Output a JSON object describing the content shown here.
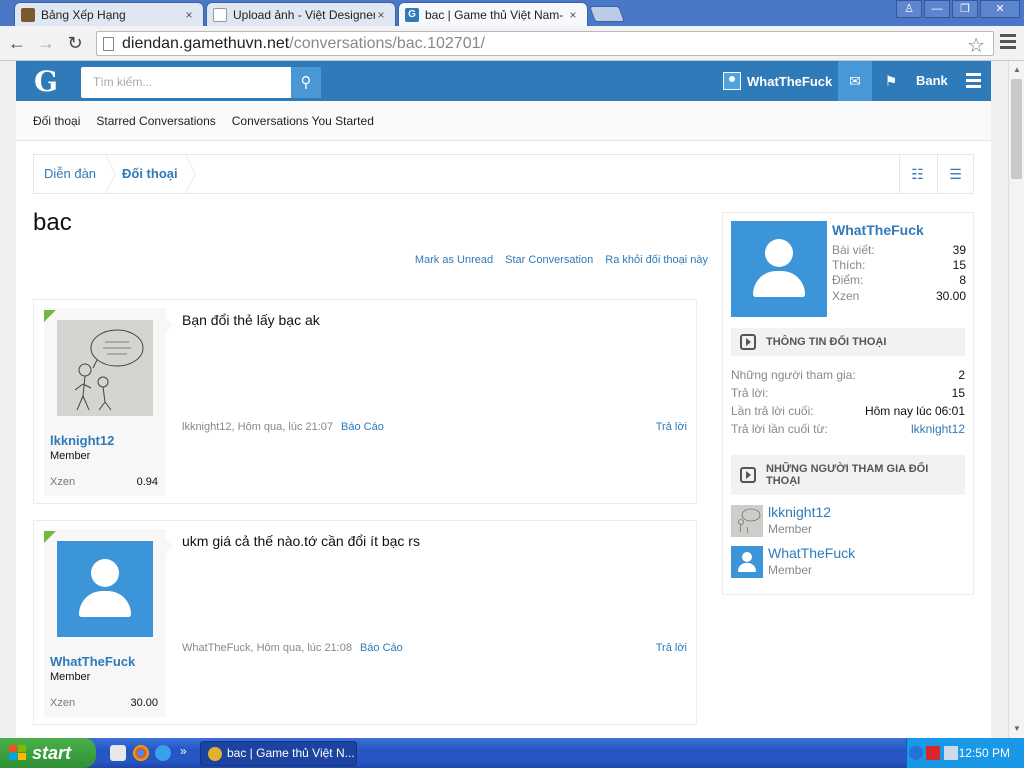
{
  "browser": {
    "tabs": [
      {
        "title": "Bảng Xếp Hạng",
        "close": "×"
      },
      {
        "title": "Upload ảnh - Việt Designer",
        "close": "×"
      },
      {
        "title": "bac | Game thủ Việt Nam- MU",
        "close": "×"
      }
    ],
    "url_host": "diendan.gamethuvn.net",
    "url_path": "/conversations/bac.102701/"
  },
  "site": {
    "logo": "G",
    "search_placeholder": "Tìm kiếm...",
    "username": "WhatTheFuck",
    "bank": "Bank",
    "subnav": [
      "Đối thoại",
      "Starred Conversations",
      "Conversations You Started"
    ],
    "breadcrumb": [
      "Diễn đàn",
      "Đối thoại"
    ]
  },
  "conversation": {
    "title": "bac",
    "actions": [
      "Mark as Unread",
      "Star Conversation",
      "Ra khỏi đối thoại này"
    ],
    "messages": [
      {
        "user": "lkknight12",
        "role": "Member",
        "xzen_label": "Xzen",
        "xzen": "0.94",
        "text": "Bạn đổi thẻ lấy bạc ak",
        "meta": "lkknight12, Hôm qua, lúc 21:07",
        "report": "Báo Cáo",
        "reply": "Trả lời"
      },
      {
        "user": "WhatTheFuck",
        "role": "Member",
        "xzen_label": "Xzen",
        "xzen": "30.00",
        "text": "ukm giá cả thế nào.tớ cần đổi ít bạc rs",
        "meta": "WhatTheFuck, Hôm qua, lúc 21:08",
        "report": "Báo Cáo",
        "reply": "Trả lời"
      }
    ]
  },
  "sidebar": {
    "name": "WhatTheFuck",
    "stats": [
      {
        "label": "Bài viết:",
        "value": "39"
      },
      {
        "label": "Thích:",
        "value": "15"
      },
      {
        "label": "Điểm:",
        "value": "8"
      },
      {
        "label": "Xzen",
        "value": "30.00"
      }
    ],
    "info_heading": "THÔNG TIN ĐỐI THOẠI",
    "info": [
      {
        "label": "Những người tham gia:",
        "value": "2"
      },
      {
        "label": "Trả lời:",
        "value": "15"
      },
      {
        "label": "Lần trả lời cuối:",
        "value": "Hôm nay lúc 06:01"
      },
      {
        "label": "Trả lời lần cuối từ:",
        "value": "lkknight12"
      }
    ],
    "participants_heading": "NHỮNG NGƯỜI THAM GIA ĐỐI THOẠI",
    "participants": [
      {
        "name": "lkknight12",
        "role": "Member"
      },
      {
        "name": "WhatTheFuck",
        "role": "Member"
      }
    ]
  },
  "taskbar": {
    "start": "start",
    "task_title": "bac | Game thủ Việt N...",
    "clock": "12:50 PM"
  }
}
